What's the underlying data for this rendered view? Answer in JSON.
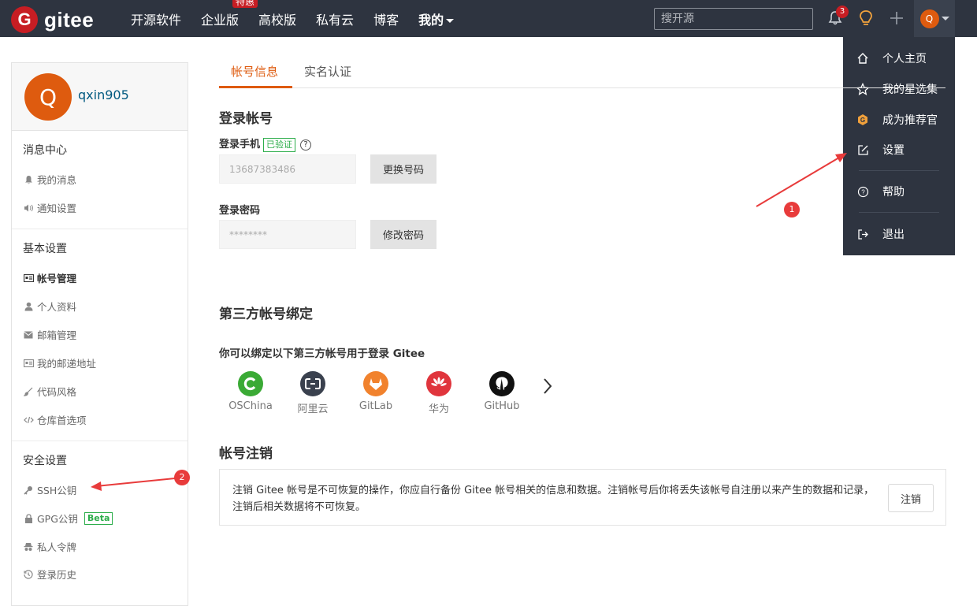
{
  "brand": {
    "logo_letter": "G",
    "name": "gitee",
    "brand_color": "#c71d23",
    "nav_bg": "#2e3440",
    "accent": "#de5b0f"
  },
  "nav": {
    "items": [
      {
        "label": "开源软件"
      },
      {
        "label": "企业版",
        "badge": "特惠"
      },
      {
        "label": "高校版"
      },
      {
        "label": "私有云"
      },
      {
        "label": "博客"
      },
      {
        "label": "我的"
      }
    ],
    "search_placeholder": "搜开源",
    "notification_count": "3",
    "avatar_letter": "Q"
  },
  "dropdown": {
    "items": [
      {
        "label": "个人主页",
        "icon": "home-icon"
      },
      {
        "label": "我的星选集",
        "icon": "star-icon"
      },
      {
        "label": "成为推荐官",
        "icon": "gitee-medal-icon"
      },
      {
        "label": "设置",
        "icon": "edit-icon"
      },
      {
        "label": "帮助",
        "icon": "help-icon"
      },
      {
        "label": "退出",
        "icon": "logout-icon"
      }
    ]
  },
  "sidebar": {
    "avatar_letter": "Q",
    "username": "qxin905",
    "sections": [
      {
        "title": "消息中心",
        "items": [
          {
            "label": "我的消息",
            "icon": "bell-icon"
          },
          {
            "label": "通知设置",
            "icon": "speaker-icon"
          }
        ]
      },
      {
        "title": "基本设置",
        "items": [
          {
            "label": "帐号管理",
            "icon": "id-card-icon",
            "active": true
          },
          {
            "label": "个人资料",
            "icon": "user-icon"
          },
          {
            "label": "邮箱管理",
            "icon": "mail-icon"
          },
          {
            "label": "我的邮递地址",
            "icon": "address-card-icon"
          },
          {
            "label": "代码风格",
            "icon": "brush-icon"
          },
          {
            "label": "仓库首选项",
            "icon": "code-icon"
          }
        ]
      },
      {
        "title": "安全设置",
        "items": [
          {
            "label": "SSH公钥",
            "icon": "key-icon"
          },
          {
            "label": "GPG公钥",
            "icon": "lock-icon",
            "badge": "Beta"
          },
          {
            "label": "私人令牌",
            "icon": "spy-icon"
          },
          {
            "label": "登录历史",
            "icon": "history-icon"
          }
        ]
      }
    ]
  },
  "tabs": [
    {
      "label": "帐号信息",
      "active": true
    },
    {
      "label": "实名认证"
    }
  ],
  "login": {
    "title": "登录帐号",
    "phone_label": "登录手机",
    "verified_badge": "已验证",
    "help_mark": "?",
    "phone_value": "13687383486",
    "change_phone_button": "更换号码",
    "password_label": "登录密码",
    "password_value": "********",
    "change_password_button": "修改密码"
  },
  "third_party": {
    "title": "第三方帐号绑定",
    "subtitle": "你可以绑定以下第三方帐号用于登录 Gitee",
    "providers": [
      {
        "label": "OSChina",
        "color": "#3aaa35"
      },
      {
        "label": "阿里云",
        "color": "#3a414e"
      },
      {
        "label": "GitLab",
        "color": "#f1822d"
      },
      {
        "label": "华为",
        "color": "#e0353d"
      },
      {
        "label": "GitHub",
        "color": "#111111"
      }
    ]
  },
  "deactivate": {
    "title": "帐号注销",
    "description": "注销 Gitee 帐号是不可恢复的操作，你应自行备份 Gitee 帐号相关的信息和数据。注销帐号后你将丢失该帐号自注册以来产生的数据和记录，注销后相关数据将不可恢复。",
    "button": "注销"
  },
  "annotations": [
    {
      "label": "1"
    },
    {
      "label": "2"
    }
  ]
}
